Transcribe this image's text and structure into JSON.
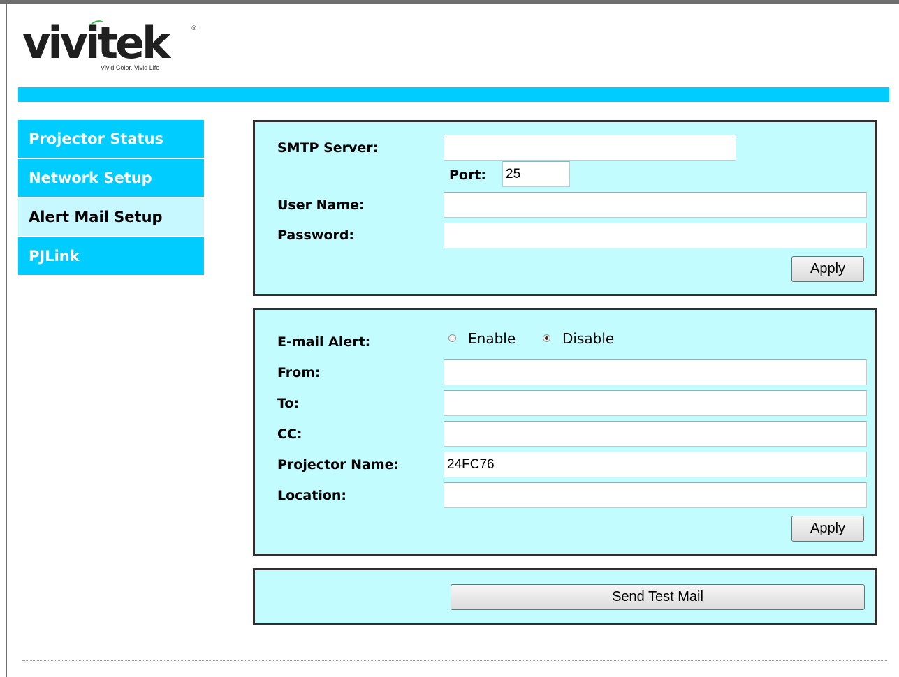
{
  "logo": {
    "word": "vivitek",
    "tagline": "Vivid Color, Vivid Life",
    "registered": "®"
  },
  "colors": {
    "accent": "#00ccff",
    "panel": "#c2fcff",
    "active_nav": "#c8f8ff",
    "logo_dot": "#2cc04a"
  },
  "nav": {
    "items": [
      {
        "label": "Projector Status",
        "active": false
      },
      {
        "label": "Network Setup",
        "active": false
      },
      {
        "label": "Alert Mail Setup",
        "active": true
      },
      {
        "label": "PJLink",
        "active": false
      }
    ]
  },
  "smtp": {
    "server_label": "SMTP Server:",
    "server_value": "",
    "port_label": "Port:",
    "port_value": "25",
    "user_label": "User Name:",
    "user_value": "",
    "password_label": "Password:",
    "password_value": "",
    "apply_label": "Apply"
  },
  "alert": {
    "email_alert_label": "E-mail Alert:",
    "enable_label": "Enable",
    "disable_label": "Disable",
    "selected": "Disable",
    "from_label": "From:",
    "from_value": "",
    "to_label": "To:",
    "to_value": "",
    "cc_label": "CC:",
    "cc_value": "",
    "projector_name_label": "Projector Name:",
    "projector_name_value": "24FC76",
    "location_label": "Location:",
    "location_value": "",
    "apply_label": "Apply"
  },
  "test": {
    "send_label": "Send Test Mail"
  }
}
